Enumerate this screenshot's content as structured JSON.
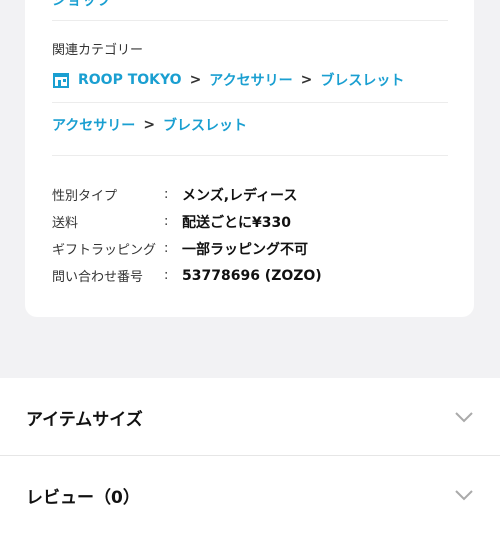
{
  "top": {
    "partial_link": "ショップ"
  },
  "related": {
    "label": "関連カテゴリー",
    "path1": [
      "ROOP TOKYO",
      "アクセサリー",
      "ブレスレット"
    ],
    "path2": [
      "アクセサリー",
      "ブレスレット"
    ],
    "separator": ">"
  },
  "specs": [
    {
      "key": "性別タイプ",
      "colon": ":",
      "value": "メンズ,レディース"
    },
    {
      "key": "送料",
      "colon": ":",
      "value": "配送ごとに¥330"
    },
    {
      "key": "ギフトラッピング",
      "colon": ":",
      "value": "一部ラッピング不可"
    },
    {
      "key": "問い合わせ番号",
      "colon": ":",
      "value": "53778696 (ZOZO)"
    }
  ],
  "accordions": [
    {
      "title": "アイテムサイズ"
    },
    {
      "title": "レビュー（0）"
    }
  ],
  "colors": {
    "link": "#1a9fd1",
    "background": "#f2f2f4"
  },
  "icons": {
    "shop": "storefront-icon",
    "expand": "chevron-down-icon"
  }
}
